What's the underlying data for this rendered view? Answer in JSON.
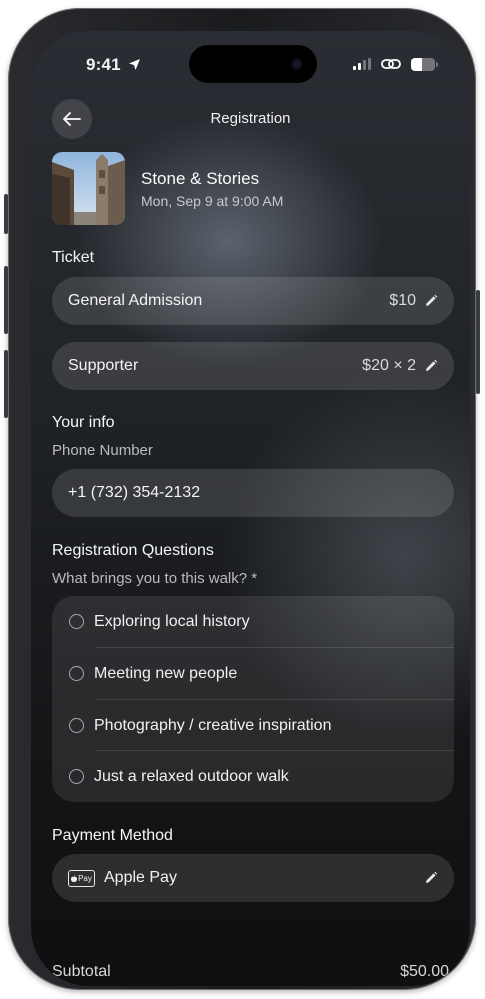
{
  "status_bar": {
    "time": "9:41"
  },
  "header": {
    "title": "Registration"
  },
  "event": {
    "name": "Stone & Stories",
    "date": "Mon, Sep 9 at 9:00 AM"
  },
  "ticket": {
    "section_title": "Ticket",
    "items": [
      {
        "label": "General Admission",
        "price": "$10"
      },
      {
        "label": "Supporter",
        "price": "$20 × 2"
      }
    ]
  },
  "your_info": {
    "section_title": "Your info",
    "phone_label": "Phone Number",
    "phone_value": "+1 (732) 354-2132"
  },
  "questions": {
    "section_title": "Registration Questions",
    "question": "What brings you to this walk? *",
    "options": [
      "Exploring local history",
      "Meeting new people",
      "Photography / creative inspiration",
      "Just a relaxed outdoor walk"
    ]
  },
  "payment": {
    "section_title": "Payment Method",
    "badge": "Pay",
    "method": "Apple Pay"
  },
  "summary": {
    "subtotal_label": "Subtotal",
    "subtotal_value": "$50.00"
  }
}
